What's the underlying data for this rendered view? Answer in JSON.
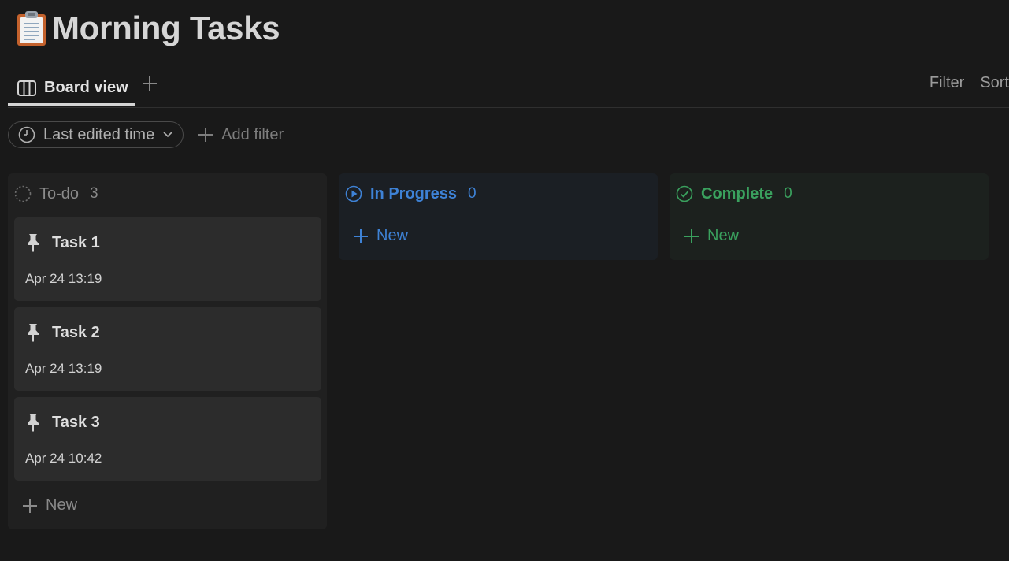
{
  "page": {
    "title": "Morning Tasks",
    "icon": "clipboard-icon"
  },
  "tabs": {
    "active_label": "Board view",
    "add_icon": "plus-icon"
  },
  "actions": {
    "filter_label": "Filter",
    "sort_label": "Sort"
  },
  "filters": {
    "sort_pill_label": "Last edited time",
    "add_filter_label": "Add filter"
  },
  "columns": [
    {
      "name": "To-do",
      "count": "3",
      "color": "#8a8a8a",
      "cards": [
        {
          "title": "Task 1",
          "date": "Apr 24 13:19"
        },
        {
          "title": "Task 2",
          "date": "Apr 24 13:19"
        },
        {
          "title": "Task 3",
          "date": "Apr 24 10:42"
        }
      ],
      "new_label": "New"
    },
    {
      "name": "In Progress",
      "count": "0",
      "color": "#3e82d6",
      "cards": [],
      "new_label": "New"
    },
    {
      "name": "Complete",
      "count": "0",
      "color": "#3aa15e",
      "cards": [],
      "new_label": "New"
    }
  ]
}
